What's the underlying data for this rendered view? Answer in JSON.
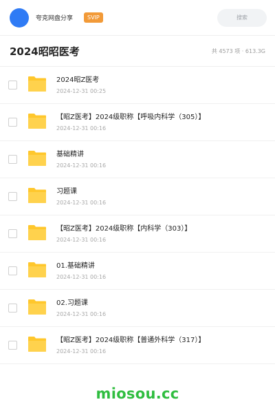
{
  "header": {
    "user_name": "夸克网盘分享",
    "badge": "SVIP",
    "search_placeholder": "搜索"
  },
  "title_bar": {
    "title": "2024昭昭医考",
    "summary": "共 4573 项 · 613.3G"
  },
  "files": [
    {
      "name": "2024昭Z医考",
      "date": "2024-12-31 00:25"
    },
    {
      "name": "【昭Z医考】2024级职称【呼吸内科学（305）】",
      "date": "2024-12-31 00:16"
    },
    {
      "name": "基础精讲",
      "date": "2024-12-31 00:16"
    },
    {
      "name": "习题课",
      "date": "2024-12-31 00:16"
    },
    {
      "name": "【昭Z医考】2024级职称【内科学（303）】",
      "date": "2024-12-31 00:16"
    },
    {
      "name": "01.基础精讲",
      "date": "2024-12-31 00:16"
    },
    {
      "name": "02.习题课",
      "date": "2024-12-31 00:16"
    },
    {
      "name": "【昭Z医考】2024级职称【普通外科学（317）】",
      "date": "2024-12-31 00:16"
    }
  ],
  "watermark": "miosou.cc",
  "colors": {
    "avatar": "#2f7bf5",
    "svip_badge": "#f29a38",
    "folder": "#ffc72c",
    "watermark": "#2fbd3f"
  }
}
